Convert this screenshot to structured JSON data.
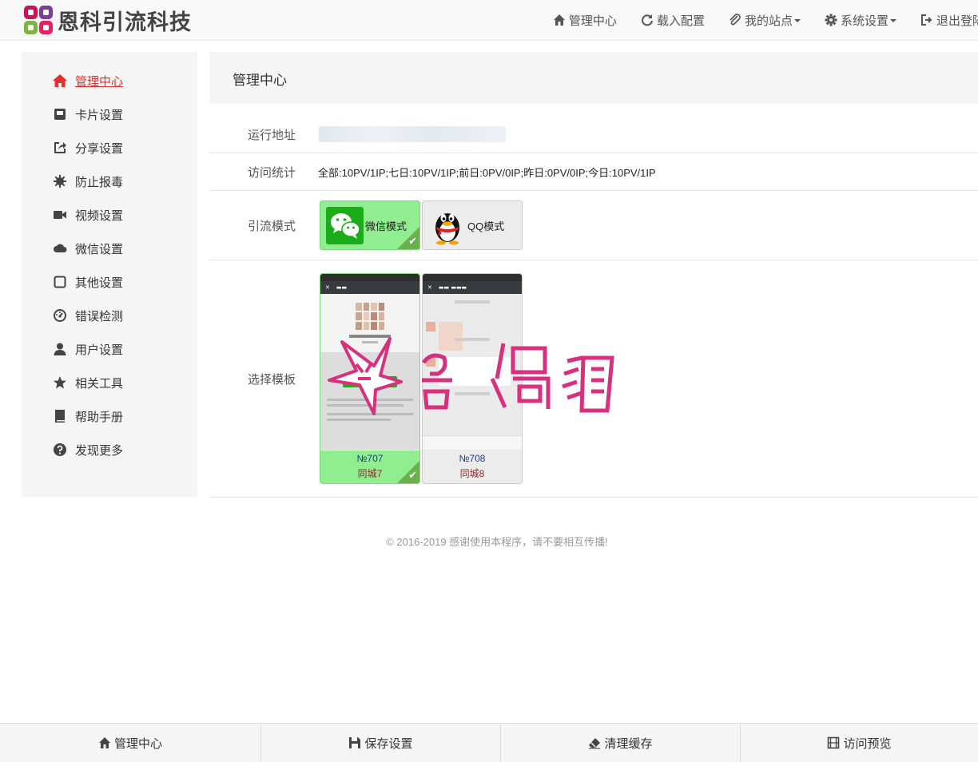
{
  "header": {
    "brand": "恩科引流科技",
    "nav": [
      {
        "label": "管理中心",
        "icon": "home-icon"
      },
      {
        "label": "载入配置",
        "icon": "refresh-icon"
      },
      {
        "label": "我的站点",
        "icon": "paperclip-icon",
        "dropdown": true
      },
      {
        "label": "系统设置",
        "icon": "gear-icon",
        "dropdown": true
      },
      {
        "label": "退出登陆",
        "icon": "logout-icon"
      }
    ]
  },
  "sidebar": {
    "items": [
      {
        "label": "管理中心",
        "icon": "home-icon",
        "active": true
      },
      {
        "label": "卡片设置",
        "icon": "card-icon"
      },
      {
        "label": "分享设置",
        "icon": "share-icon"
      },
      {
        "label": "防止报毒",
        "icon": "shield-burst-icon"
      },
      {
        "label": "视频设置",
        "icon": "video-icon"
      },
      {
        "label": "微信设置",
        "icon": "cloud-icon"
      },
      {
        "label": "其他设置",
        "icon": "square-icon"
      },
      {
        "label": "错误检测",
        "icon": "dashboard-icon"
      },
      {
        "label": "用户设置",
        "icon": "user-icon"
      },
      {
        "label": "相关工具",
        "icon": "star-icon"
      },
      {
        "label": "帮助手册",
        "icon": "book-icon"
      },
      {
        "label": "发现更多",
        "icon": "question-icon"
      }
    ]
  },
  "main": {
    "title": "管理中心",
    "rows": {
      "address_label": "运行地址",
      "stats_label": "访问统计",
      "stats_value": "全部:10PV/1IP;七日:10PV/1IP;前日:0PV/0IP;昨日:0PV/0IP;今日:10PV/1IP",
      "mode_label": "引流模式",
      "template_label": "选择模板"
    },
    "modes": [
      {
        "label": "微信模式",
        "icon": "wechat-icon",
        "selected": true
      },
      {
        "label": "QQ模式",
        "icon": "qq-penguin-icon",
        "selected": false
      }
    ],
    "templates": [
      {
        "number": "№707",
        "name": "同城7",
        "selected": true
      },
      {
        "number": "№708",
        "name": "同城8",
        "selected": false
      }
    ],
    "watermark": "奇偶猫"
  },
  "footer": {
    "note": "© 2016-2019   感谢使用本程序，请不要相互传播!"
  },
  "bottombar": {
    "items": [
      {
        "label": "管理中心",
        "icon": "home-icon"
      },
      {
        "label": "保存设置",
        "icon": "save-icon"
      },
      {
        "label": "清理缓存",
        "icon": "eraser-icon"
      },
      {
        "label": "访问预览",
        "icon": "film-icon"
      }
    ]
  },
  "colors": {
    "active_red": "#e4302b",
    "selected_green": "#90ee90",
    "watermark_pink": "#d6307f"
  }
}
